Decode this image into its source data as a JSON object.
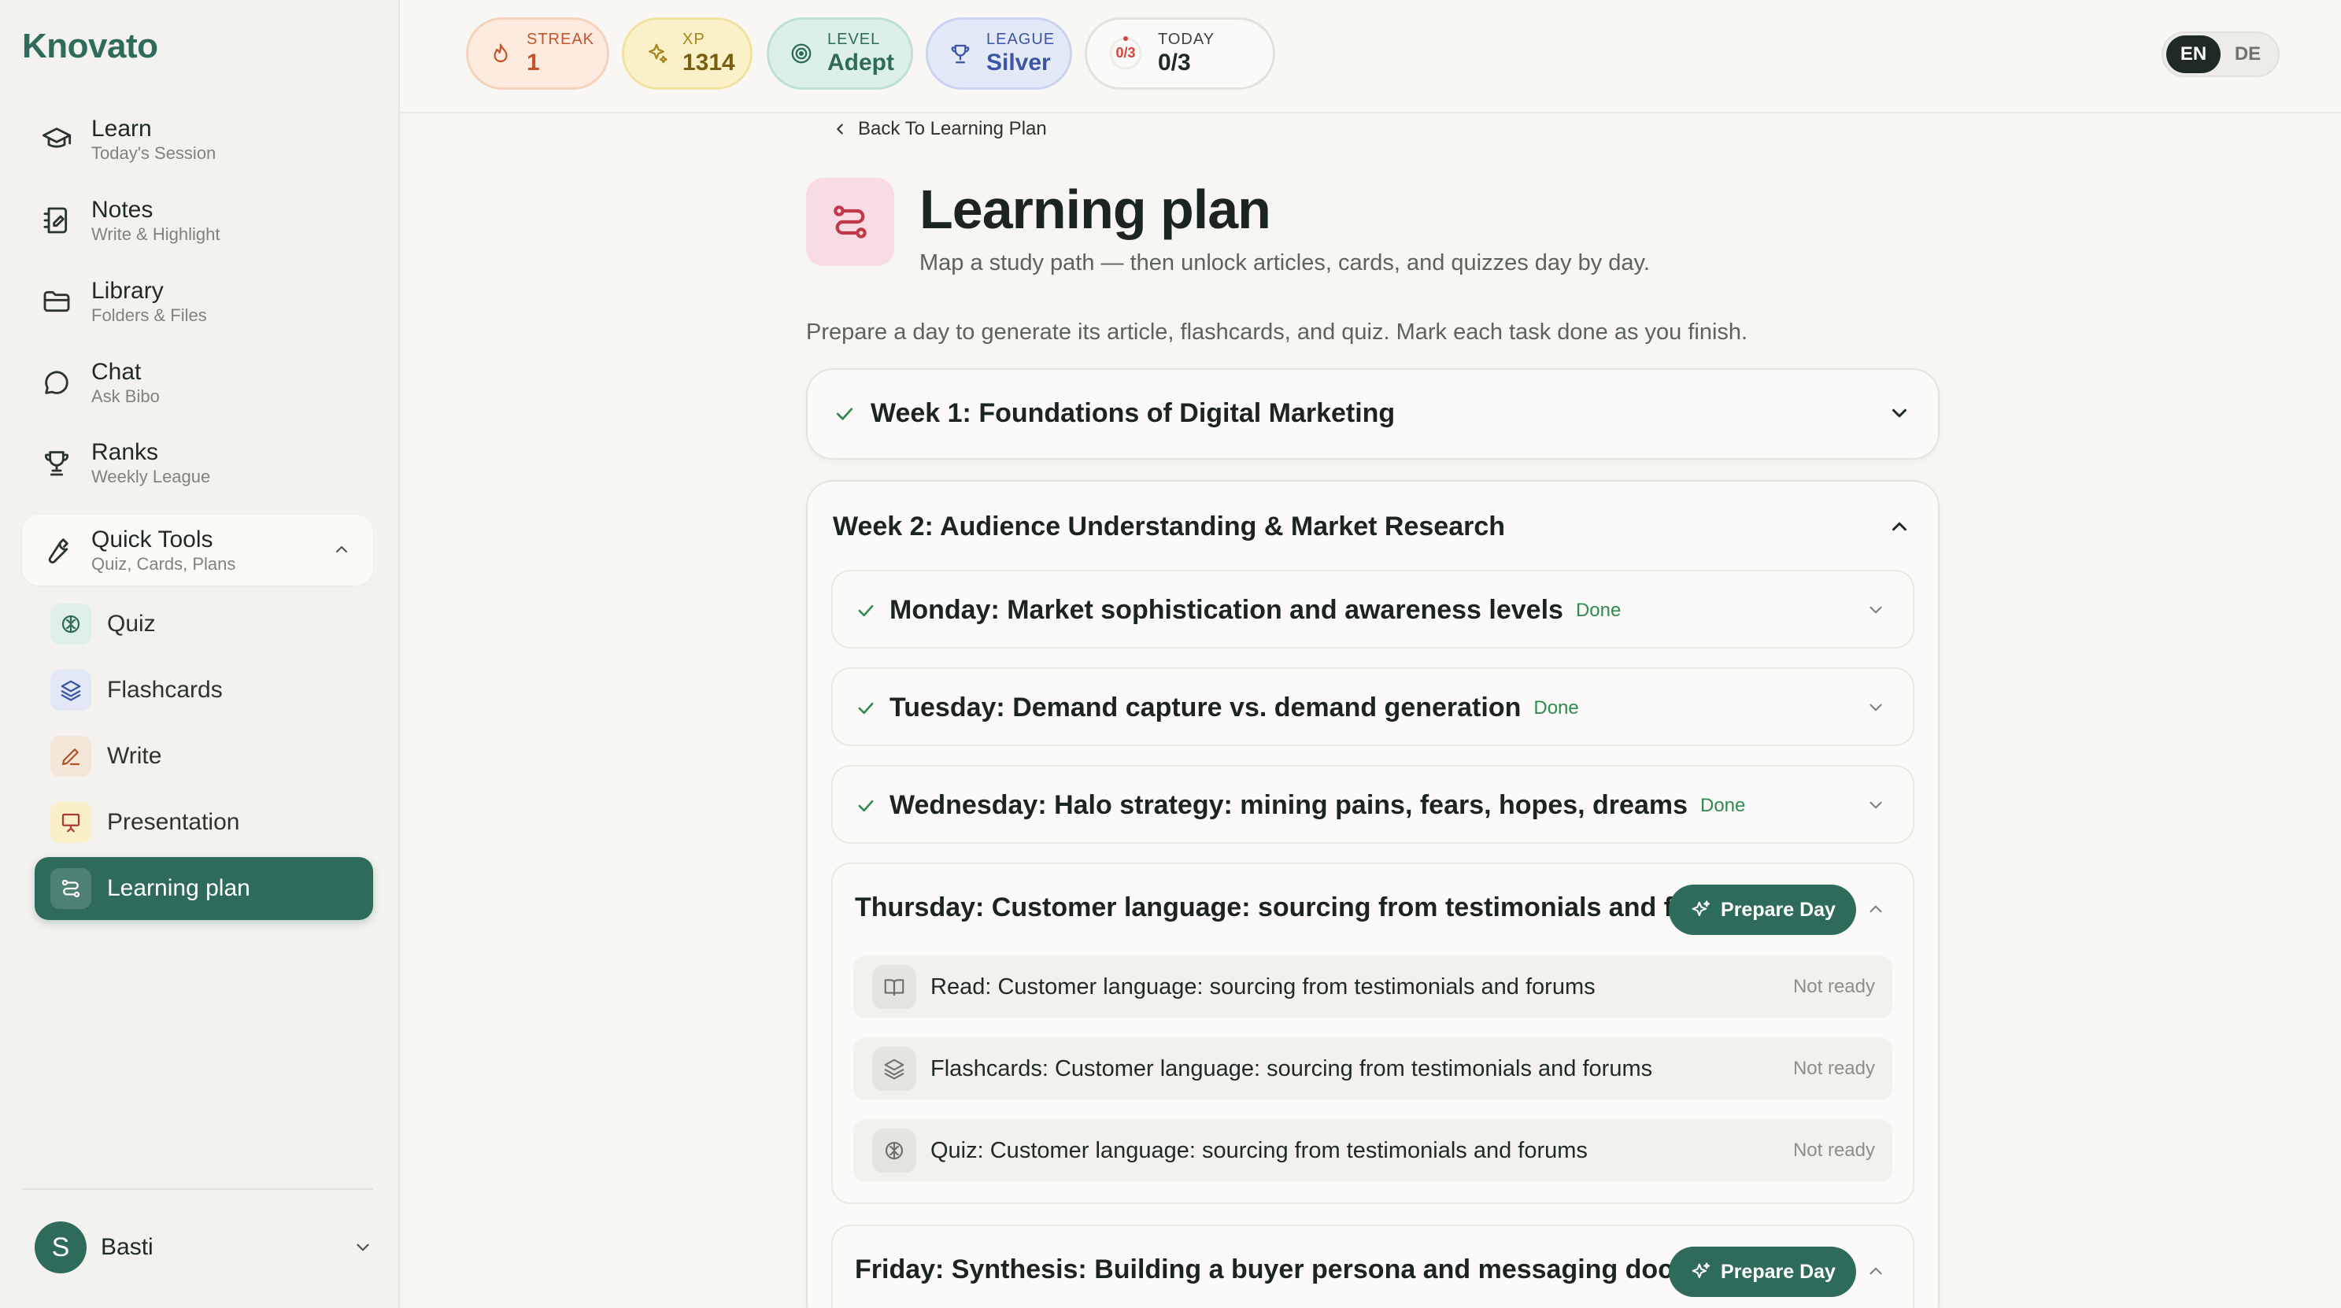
{
  "app": {
    "logo": "Knovato"
  },
  "sidebar": {
    "items": [
      {
        "title": "Learn",
        "subtitle": "Today's Session",
        "icon": "graduation-cap-icon"
      },
      {
        "title": "Notes",
        "subtitle": "Write & Highlight",
        "icon": "notebook-icon"
      },
      {
        "title": "Library",
        "subtitle": "Folders & Files",
        "icon": "folder-icon"
      },
      {
        "title": "Chat",
        "subtitle": "Ask Bibo",
        "icon": "chat-bubble-icon"
      },
      {
        "title": "Ranks",
        "subtitle": "Weekly League",
        "icon": "trophy-icon"
      },
      {
        "title": "Quick Tools",
        "subtitle": "Quiz, Cards, Plans",
        "icon": "wrench-icon"
      }
    ],
    "tools": [
      {
        "label": "Quiz",
        "icon": "brain-icon"
      },
      {
        "label": "Flashcards",
        "icon": "layers-icon"
      },
      {
        "label": "Write",
        "icon": "pen-icon"
      },
      {
        "label": "Presentation",
        "icon": "presentation-icon"
      },
      {
        "label": "Learning plan",
        "icon": "route-icon",
        "active": true
      }
    ],
    "user": {
      "initial": "S",
      "name": "Basti"
    }
  },
  "topbar": {
    "streak": {
      "label": "STREAK",
      "value": "1"
    },
    "xp": {
      "label": "XP",
      "value": "1314"
    },
    "level": {
      "label": "LEVEL",
      "value": "Adept"
    },
    "league": {
      "label": "LEAGUE",
      "value": "Silver"
    },
    "today": {
      "label": "TODAY",
      "value": "0/3",
      "ring_text": "0/3"
    },
    "languages": [
      "EN",
      "DE"
    ],
    "active_language": "EN"
  },
  "main": {
    "back_label": "Back To Learning Plan",
    "title": "Learning plan",
    "subtitle": "Map a study path — then unlock articles, cards, and quizzes day by day.",
    "intro": "Prepare a day to generate its article, flashcards, and quiz. Mark each task done as you finish.",
    "weeks": [
      {
        "title": "Week 1: Foundations of Digital Marketing",
        "completed": true,
        "expanded": false
      },
      {
        "title": "Week 2: Audience Understanding & Market Research",
        "expanded": true,
        "days": [
          {
            "title": "Monday: Market sophistication and awareness levels",
            "status": "Done"
          },
          {
            "title": "Tuesday: Demand capture vs. demand generation",
            "status": "Done"
          },
          {
            "title": "Wednesday: Halo strategy: mining pains, fears, hopes, dreams",
            "status": "Done"
          },
          {
            "title": "Thursday: Customer language: sourcing from testimonials and fo…",
            "action": "Prepare Day",
            "tasks": [
              {
                "label": "Read: Customer language: sourcing from testimonials and forums",
                "status": "Not ready",
                "icon": "book-icon"
              },
              {
                "label": "Flashcards: Customer language: sourcing from testimonials and forums",
                "status": "Not ready",
                "icon": "layers-icon"
              },
              {
                "label": "Quiz: Customer language: sourcing from testimonials and forums",
                "status": "Not ready",
                "icon": "brain-icon"
              }
            ]
          },
          {
            "title": "Friday: Synthesis: Building a buyer persona and messaging docu…",
            "action": "Prepare Day"
          }
        ]
      }
    ]
  },
  "colors": {
    "brand": "#2f6b5b",
    "done_green": "#2e8a4e",
    "plan_icon_bg": "#f7dde3",
    "streak": "#c4552a",
    "xp": "#8a6a10",
    "level": "#2f6b5b",
    "league": "#3c55a5"
  }
}
